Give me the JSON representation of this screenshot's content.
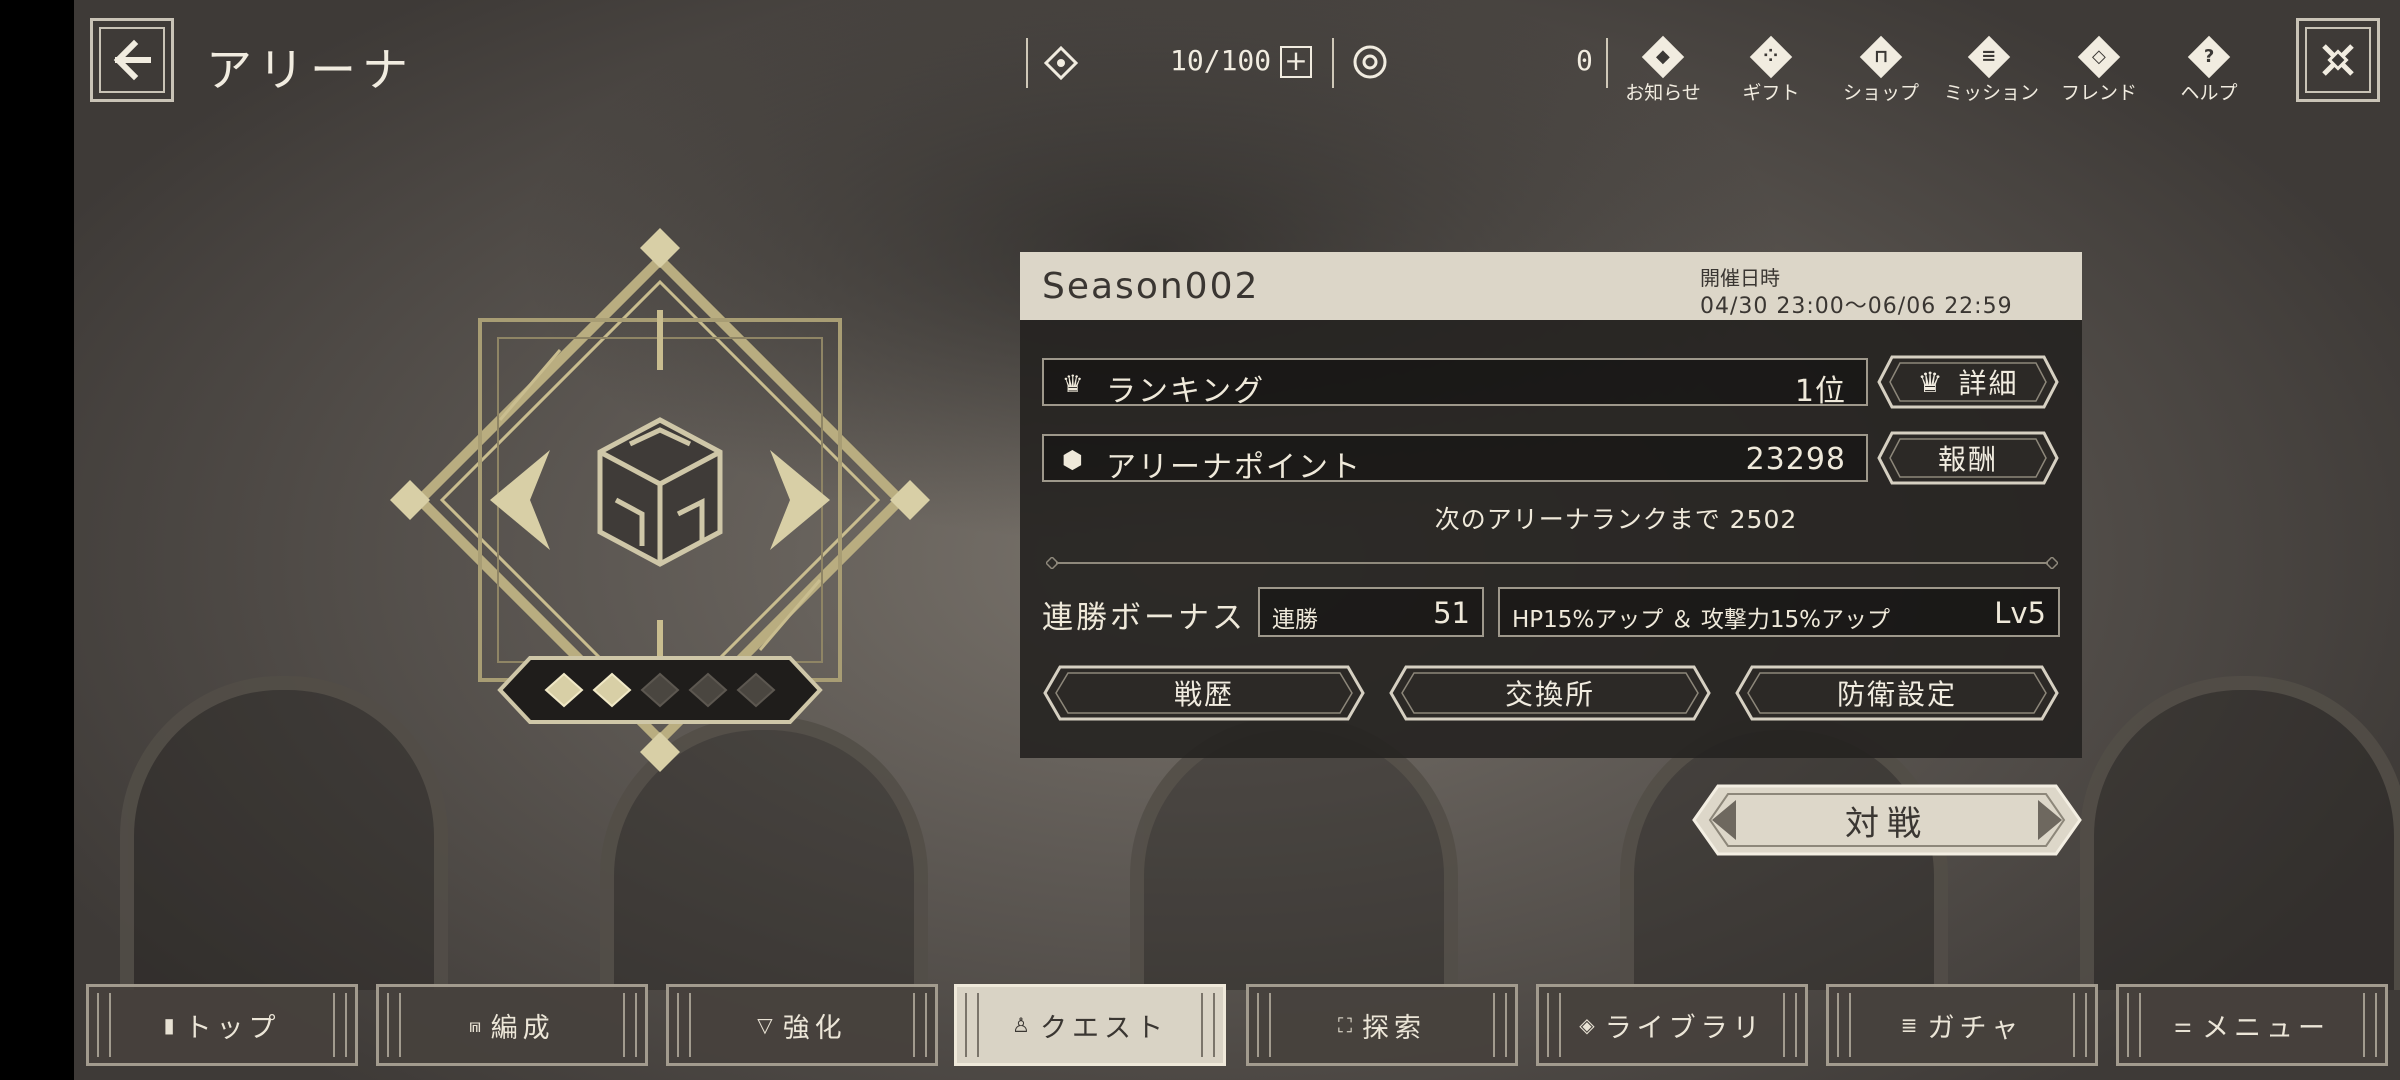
{
  "header": {
    "title": "アリーナ",
    "stamina_value": "10/100",
    "stamina_plus": "+",
    "currency_value": "0"
  },
  "top_icons": [
    {
      "label": "お知らせ",
      "icon": "◆"
    },
    {
      "label": "ギフト",
      "icon": "⁘"
    },
    {
      "label": "ショップ",
      "icon": "⊓"
    },
    {
      "label": "ミッション",
      "icon": "≡"
    },
    {
      "label": "フレンド",
      "icon": "◇"
    },
    {
      "label": "ヘルプ",
      "icon": "?"
    }
  ],
  "emblem": {
    "rank_stars_filled": 2,
    "rank_stars_total": 5
  },
  "season": {
    "name": "Season002",
    "date_label": "開催日時",
    "date_value": "04/30 23:00～06/06 22:59"
  },
  "ranking": {
    "label": "ランキング",
    "value": "1位",
    "details_button": "詳細",
    "icon": "♛"
  },
  "arena_points": {
    "label": "アリーナポイント",
    "value": "23298",
    "reward_button": "報酬",
    "icon": "⬢"
  },
  "next_rank_text": "次のアリーナランクまで 2502",
  "streak": {
    "title": "連勝ボーナス",
    "count_label": "連勝",
    "count_value": "51",
    "bonus_text": "HP15%アップ ＆ 攻撃力15%アップ",
    "bonus_level": "Lv5"
  },
  "actions": {
    "history": "戦歴",
    "exchange": "交換所",
    "defense": "防衛設定"
  },
  "battle_button": "対戦",
  "nav": [
    {
      "label": "トップ",
      "icon": "▮"
    },
    {
      "label": "編成",
      "icon": "⩎"
    },
    {
      "label": "強化",
      "icon": "▽"
    },
    {
      "label": "クエスト",
      "icon": "♙"
    },
    {
      "label": "探索",
      "icon": "⛶"
    },
    {
      "label": "ライブラリ",
      "icon": "◈"
    },
    {
      "label": "ガチャ",
      "icon": "≣"
    },
    {
      "label": "メニュー",
      "icon": "⚌"
    }
  ],
  "active_nav_index": 3,
  "colors": {
    "panel_bg": "#252220",
    "accent_light": "#dcd6c8",
    "gold": "#c8bc8a"
  }
}
